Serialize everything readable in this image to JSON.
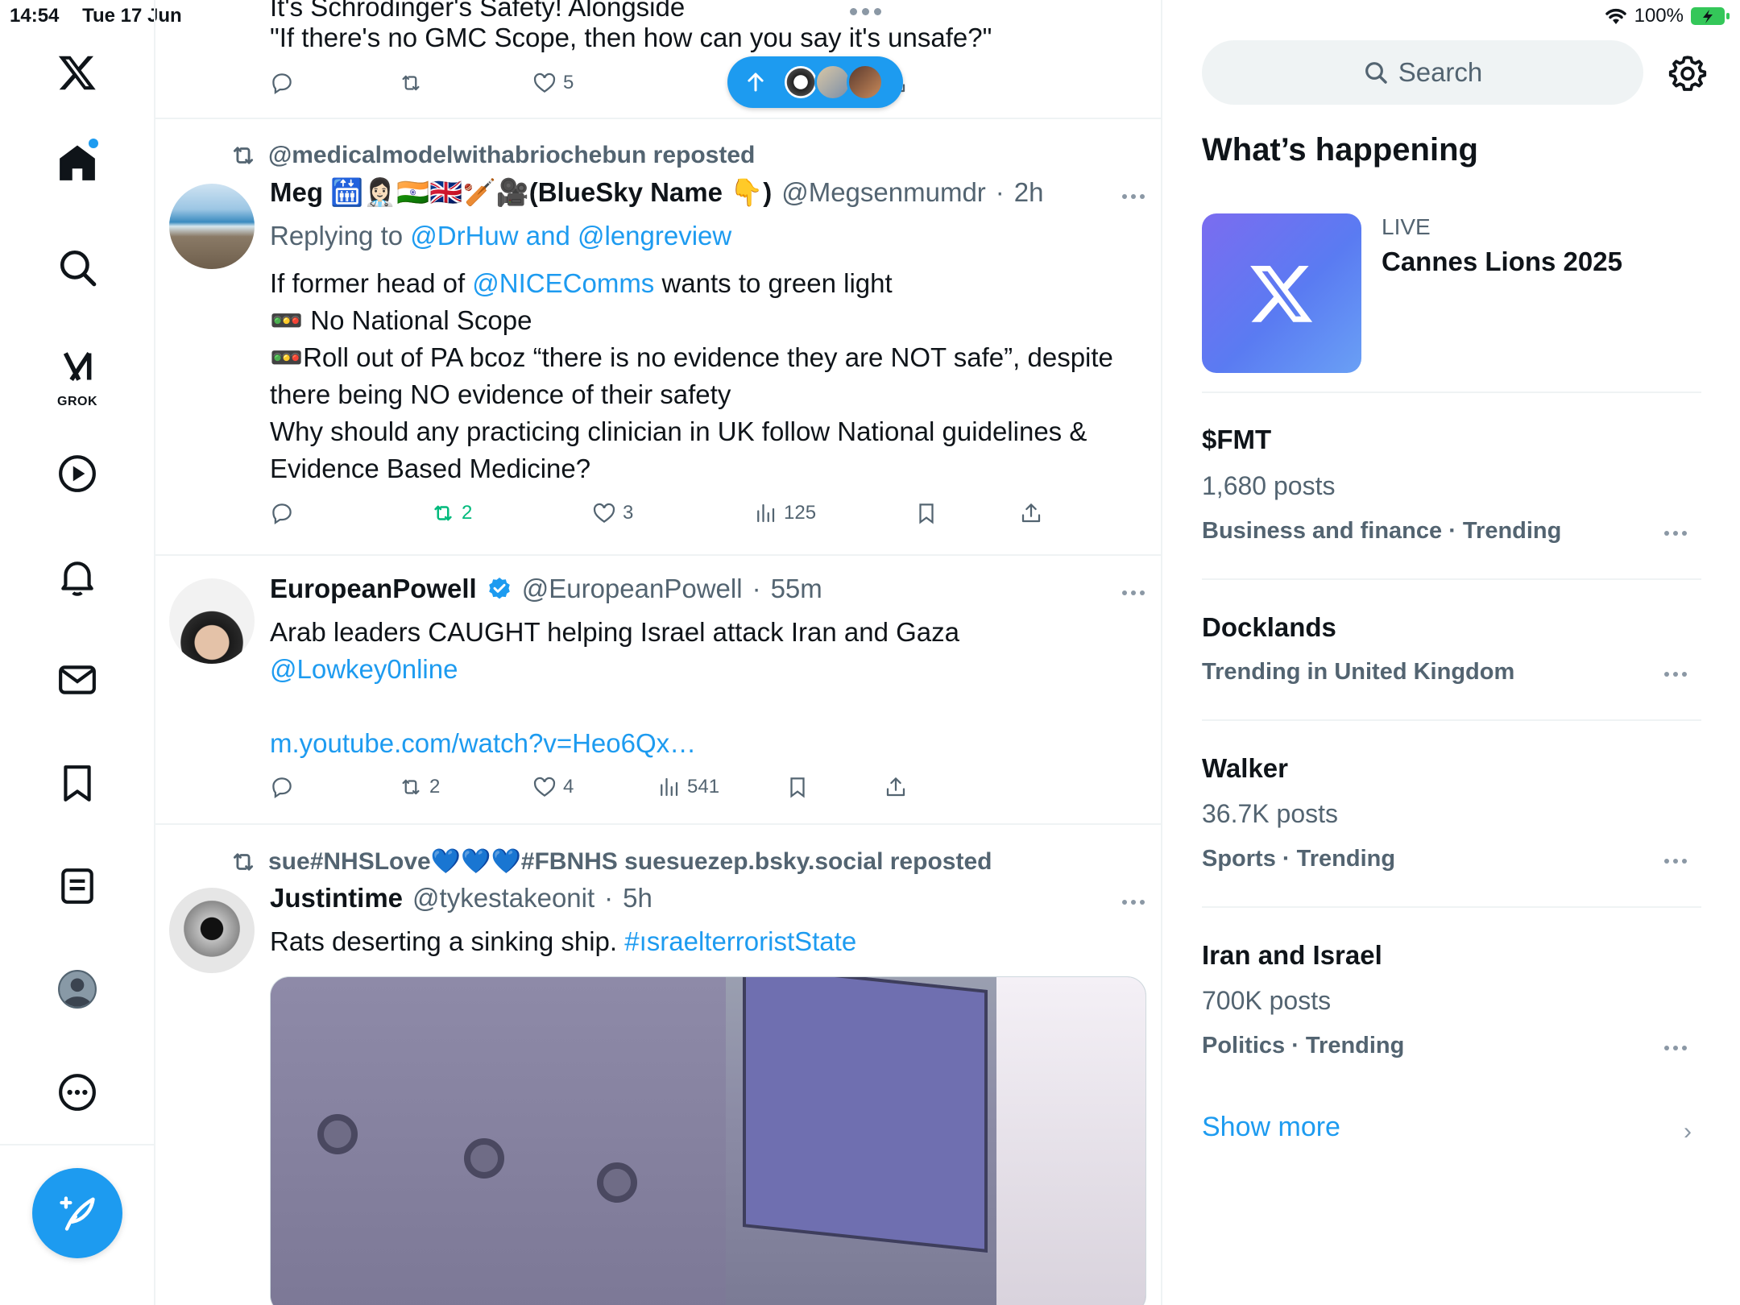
{
  "status": {
    "time": "14:54",
    "date": "Tue 17 Jun",
    "battery": "100%"
  },
  "nav": {
    "items": [
      "home",
      "search",
      "grok",
      "videos",
      "notifications",
      "messages",
      "bookmarks",
      "lists",
      "profile",
      "more"
    ],
    "grok_label": "GROK",
    "accent": "#1d9bf0"
  },
  "feed": {
    "partial_tweet": {
      "line1": "It's Schrödinger's Safety! Alongside",
      "line2": "\"If there's no GMC Scope, then how can you say it's unsafe?\"",
      "likes": "5"
    },
    "tweets": [
      {
        "repost_by": "@medicalmodelwithabriochebun reposted",
        "name": "Meg 🛗👩🏻‍⚕️🇮🇳🇬🇧🏏🎥(BlueSky Name 👇)",
        "handle": "@Megsenmumdr",
        "time": "2h",
        "replying_prefix": "Replying to ",
        "replying_to": "@DrHuw and @lengreview",
        "text_pre_mention": "If former head of ",
        "mention": "@NICEComms",
        "text_post_mention": " wants to green light",
        "line2_emoji": "🚥",
        "line2": " No National Scope",
        "line3_emoji": "🚥",
        "line3": "Roll out of PA bcoz “there is no evidence they are NOT safe”, despite there being NO evidence of their safety",
        "line4": "Why should any practicing clinician in UK follow National guidelines & Evidence Based Medicine?",
        "retweets": "2",
        "likes": "3",
        "views": "125"
      },
      {
        "name": "EuropeanPowell",
        "handle": "@EuropeanPowell",
        "time": "55m",
        "text": "Arab leaders CAUGHT helping Israel attack Iran and Gaza",
        "mention": "@Lowkey0nline",
        "link": "m.youtube.com/watch?v=Heo6Qx…",
        "retweets": "2",
        "likes": "4",
        "views": "541"
      },
      {
        "repost_by": "sue#NHSLove💙💙💙#FBNHS suesuezep.bsky.social reposted",
        "name": "Justintime",
        "handle": "@tykestakeonit",
        "time": "5h",
        "text": "Rats deserting a sinking ship. ",
        "hashtag": "#ısraelterroristState"
      }
    ]
  },
  "sidebar": {
    "search_placeholder": "Search",
    "section_title": "What’s happening",
    "live": {
      "label": "LIVE",
      "title": "Cannes Lions 2025"
    },
    "trends": [
      {
        "name": "$FMT",
        "count": "1,680 posts",
        "category": "Business and finance · Trending"
      },
      {
        "name": "Docklands",
        "count": "",
        "category": "Trending in United Kingdom"
      },
      {
        "name": "Walker",
        "count": "36.7K posts",
        "category": "Sports · Trending"
      },
      {
        "name": "Iran and Israel",
        "count": "700K posts",
        "category": "Politics · Trending"
      }
    ],
    "show_more": "Show more"
  }
}
